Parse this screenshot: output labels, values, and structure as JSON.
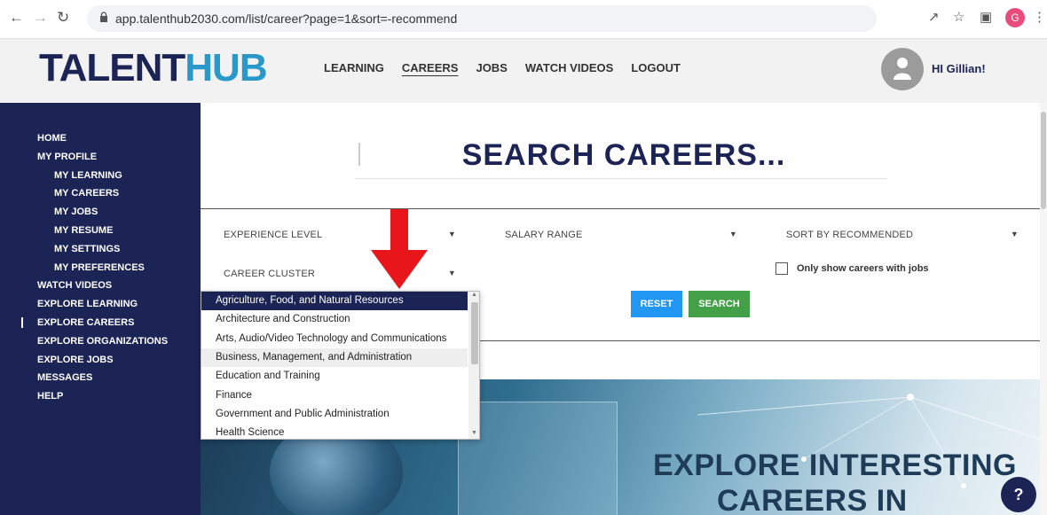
{
  "browser": {
    "url": "app.talenthub2030.com/list/career?page=1&sort=-recommend",
    "profile_initial": "G"
  },
  "header": {
    "logo_part1": "TALENT",
    "logo_part2": "HUB",
    "nav": [
      "LEARNING",
      "CAREERS",
      "JOBS",
      "WATCH VIDEOS",
      "LOGOUT"
    ],
    "active_nav": "CAREERS",
    "greeting": "HI Gillian!"
  },
  "sidebar": {
    "items": [
      {
        "label": "HOME",
        "sub": false
      },
      {
        "label": "MY PROFILE",
        "sub": false
      },
      {
        "label": "MY LEARNING",
        "sub": true
      },
      {
        "label": "MY CAREERS",
        "sub": true
      },
      {
        "label": "MY JOBS",
        "sub": true
      },
      {
        "label": "MY RESUME",
        "sub": true
      },
      {
        "label": "MY SETTINGS",
        "sub": true
      },
      {
        "label": "MY PREFERENCES",
        "sub": true
      },
      {
        "label": "WATCH VIDEOS",
        "sub": false
      },
      {
        "label": "EXPLORE LEARNING",
        "sub": false
      },
      {
        "label": "EXPLORE CAREERS",
        "sub": false,
        "active": true
      },
      {
        "label": "EXPLORE ORGANIZATIONS",
        "sub": false
      },
      {
        "label": "EXPLORE JOBS",
        "sub": false
      },
      {
        "label": "MESSAGES",
        "sub": false
      },
      {
        "label": "HELP",
        "sub": false
      }
    ]
  },
  "main": {
    "title": "SEARCH CAREERS...",
    "filters": {
      "experience": "EXPERIENCE LEVEL",
      "salary": "SALARY RANGE",
      "sort": "SORT BY RECOMMENDED",
      "cluster": "CAREER CLUSTER"
    },
    "checkbox_label": "Only show careers with jobs",
    "reset_label": "RESET",
    "search_label": "SEARCH",
    "banner_line1": "EXPLORE INTERESTING",
    "banner_line2": "CAREERS IN",
    "help_icon_glyph": "?"
  },
  "dropdown": {
    "options": [
      "Agriculture, Food, and Natural Resources",
      "Architecture and Construction",
      "Arts, Audio/Video Technology and Communications",
      "Business, Management, and Administration",
      "Education and Training",
      "Finance",
      "Government and Public Administration",
      "Health Science"
    ],
    "selected_index": 0,
    "hover_index": 3
  },
  "colors": {
    "navy": "#1c2456",
    "brand_blue": "#2a98c9",
    "reset_blue": "#2196f3",
    "search_green": "#43a047",
    "annotation_red": "#e8161b"
  }
}
